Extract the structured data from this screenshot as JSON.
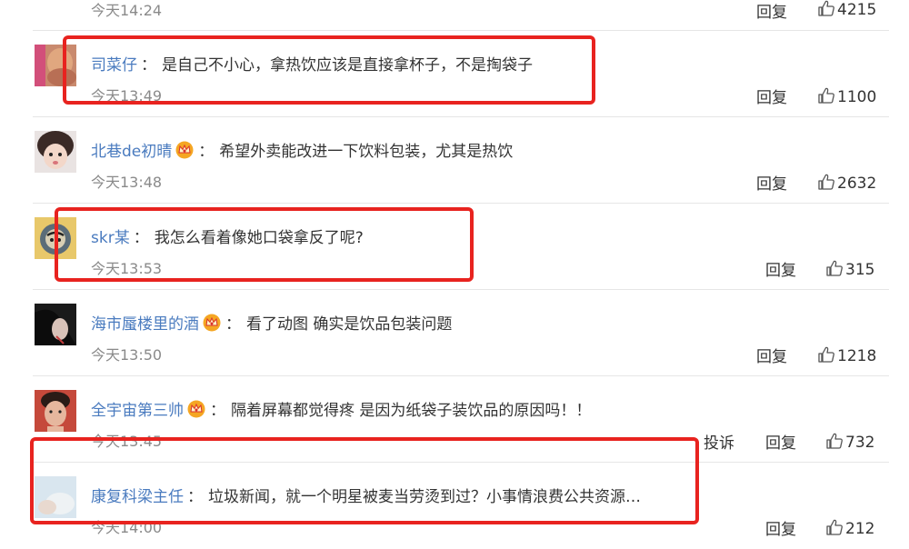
{
  "top_partial": {
    "time": "今天14:24",
    "reply": "回复",
    "likes": "4215"
  },
  "comments": [
    {
      "user": "司菜仔",
      "sep": "：",
      "vip": false,
      "text": "是自己不小心，拿热饮应该是直接拿杯子，不是掏袋子",
      "time": "今天13:49",
      "reply": "回复",
      "likes": "1100"
    },
    {
      "user": "北巷de初晴",
      "sep": "：",
      "vip": true,
      "text": "希望外卖能改进一下饮料包装，尤其是热饮",
      "time": "今天13:48",
      "reply": "回复",
      "likes": "2632"
    },
    {
      "user": "skr某",
      "sep": "：",
      "vip": false,
      "text": "我怎么看着像她口袋拿反了呢?",
      "time": "今天13:53",
      "reply": "回复",
      "likes": "315"
    },
    {
      "user": "海市蜃楼里的酒",
      "sep": "：",
      "vip": true,
      "text": "看了动图 确实是饮品包装问题",
      "time": "今天13:50",
      "reply": "回复",
      "likes": "1218"
    },
    {
      "user": "全宇宙第三帅",
      "sep": "：",
      "vip": true,
      "text": "隔着屏幕都觉得疼 是因为纸袋子装饮品的原因吗！！",
      "time": "今天13:45",
      "reply": "回复",
      "report": "投诉",
      "likes": "732"
    },
    {
      "user": "康复科梁主任",
      "sep": "：",
      "vip": false,
      "text": "垃圾新闻，就一个明星被麦当劳烫到过？小事情浪费公共资源…",
      "time": "今天14:00",
      "reply": "回复",
      "likes": "212"
    }
  ],
  "colors": {
    "username": "#4a7bbf",
    "highlight_box": "#e8231f",
    "time": "#8a8a8a",
    "crown": "#f5a623"
  },
  "icons": {
    "like": "thumbs-up-icon",
    "vip": "crown-icon"
  }
}
